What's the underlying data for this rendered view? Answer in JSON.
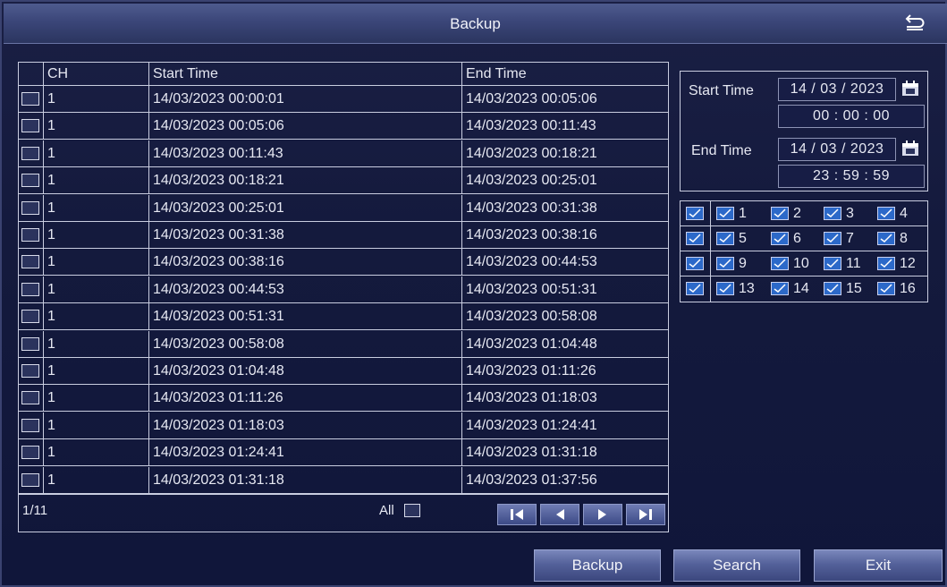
{
  "window": {
    "title": "Backup"
  },
  "table": {
    "headers": {
      "ch": "CH",
      "start": "Start Time",
      "end": "End Time"
    },
    "rows": [
      {
        "ch": "1",
        "start": "14/03/2023 00:00:01",
        "end": "14/03/2023 00:05:06"
      },
      {
        "ch": "1",
        "start": "14/03/2023 00:05:06",
        "end": "14/03/2023 00:11:43"
      },
      {
        "ch": "1",
        "start": "14/03/2023 00:11:43",
        "end": "14/03/2023 00:18:21"
      },
      {
        "ch": "1",
        "start": "14/03/2023 00:18:21",
        "end": "14/03/2023 00:25:01"
      },
      {
        "ch": "1",
        "start": "14/03/2023 00:25:01",
        "end": "14/03/2023 00:31:38"
      },
      {
        "ch": "1",
        "start": "14/03/2023 00:31:38",
        "end": "14/03/2023 00:38:16"
      },
      {
        "ch": "1",
        "start": "14/03/2023 00:38:16",
        "end": "14/03/2023 00:44:53"
      },
      {
        "ch": "1",
        "start": "14/03/2023 00:44:53",
        "end": "14/03/2023 00:51:31"
      },
      {
        "ch": "1",
        "start": "14/03/2023 00:51:31",
        "end": "14/03/2023 00:58:08"
      },
      {
        "ch": "1",
        "start": "14/03/2023 00:58:08",
        "end": "14/03/2023 01:04:48"
      },
      {
        "ch": "1",
        "start": "14/03/2023 01:04:48",
        "end": "14/03/2023 01:11:26"
      },
      {
        "ch": "1",
        "start": "14/03/2023 01:11:26",
        "end": "14/03/2023 01:18:03"
      },
      {
        "ch": "1",
        "start": "14/03/2023 01:18:03",
        "end": "14/03/2023 01:24:41"
      },
      {
        "ch": "1",
        "start": "14/03/2023 01:24:41",
        "end": "14/03/2023 01:31:18"
      },
      {
        "ch": "1",
        "start": "14/03/2023 01:31:18",
        "end": "14/03/2023 01:37:56"
      }
    ],
    "page_info": "1/11",
    "all_label": "All"
  },
  "filter": {
    "start_label": "Start Time",
    "start_date": "14 / 03 / 2023",
    "start_time": "00 : 00 : 00",
    "end_label": "End Time",
    "end_date": "14 / 03 / 2023",
    "end_time": "23 : 59 : 59"
  },
  "channels": {
    "rows": [
      [
        "1",
        "2",
        "3",
        "4"
      ],
      [
        "5",
        "6",
        "7",
        "8"
      ],
      [
        "9",
        "10",
        "11",
        "12"
      ],
      [
        "13",
        "14",
        "15",
        "16"
      ]
    ]
  },
  "buttons": {
    "backup": "Backup",
    "search": "Search",
    "exit": "Exit"
  },
  "colors": {
    "accent": "#2c69c9",
    "background": "#10163a",
    "title_bar": "#3b4679"
  }
}
